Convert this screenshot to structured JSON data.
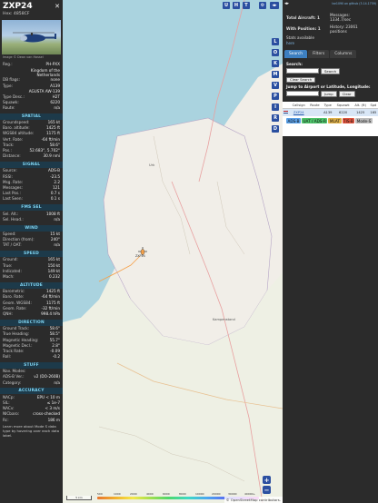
{
  "info": {
    "callsign": "ZXP24",
    "hex_line": "Hex: 4858CF",
    "photo_credit": "Image © Dean van Hassel",
    "basic": [
      {
        "k": "Reg.:",
        "v": "PH-PXX"
      },
      {
        "k": "",
        "v": "Kingdom of the Netherlands"
      },
      {
        "k": "DB flags:",
        "v": "none"
      },
      {
        "k": "Type:",
        "v": "A139"
      },
      {
        "k": "",
        "v": "AGUSTA AW-139"
      },
      {
        "k": "Type Desc.:",
        "v": "H2T"
      },
      {
        "k": "Squawk:",
        "v": "6220"
      },
      {
        "k": "Route:",
        "v": "n/a"
      }
    ],
    "sections": [
      {
        "title": "SPATIAL",
        "rows": [
          {
            "k": "Groundspeed:",
            "v": "165 kt"
          },
          {
            "k": "Baro. altitude:",
            "v": "1425 ft"
          },
          {
            "k": "WGS84 altitude:",
            "v": "1175 ft"
          },
          {
            "k": "Vert. Rate:",
            "v": "-64 ft/min"
          },
          {
            "k": "Track:",
            "v": "58.6°"
          },
          {
            "k": "Pos.:",
            "v": "52.683°, 5.702°"
          },
          {
            "k": "Distance:",
            "v": "30.9 nmi"
          }
        ]
      },
      {
        "title": "SIGNAL",
        "rows": [
          {
            "k": "Source:",
            "v": "ADS-B"
          },
          {
            "k": "RSSI:",
            "v": "-23.5"
          },
          {
            "k": "Msg. Rate:",
            "v": "2.2"
          },
          {
            "k": "Messages:",
            "v": "121"
          },
          {
            "k": "Last Pos.:",
            "v": "0.7 s"
          },
          {
            "k": "Last Seen:",
            "v": "0.1 s"
          }
        ]
      },
      {
        "title": "FMS SEL",
        "rows": [
          {
            "k": "Sel. Alt.:",
            "v": "1008 ft"
          },
          {
            "k": "Sel. Head.:",
            "v": "n/a"
          }
        ]
      },
      {
        "title": "WIND",
        "rows": [
          {
            "k": "Speed:",
            "v": "15 kt"
          },
          {
            "k": "Direction (from):",
            "v": "240°"
          },
          {
            "k": "TAT / OAT:",
            "v": "n/a"
          }
        ]
      },
      {
        "title": "SPEED",
        "rows": [
          {
            "k": "Ground:",
            "v": "165 kt"
          },
          {
            "k": "True:",
            "v": "150 kt"
          },
          {
            "k": "Indicated:",
            "v": "149 kt"
          },
          {
            "k": "Mach:",
            "v": "0.232"
          }
        ]
      },
      {
        "title": "ALTITUDE",
        "rows": [
          {
            "k": "Barometric:",
            "v": "1425 ft"
          },
          {
            "k": "Baro. Rate:",
            "v": "-64 ft/min"
          },
          {
            "k": "Geom. WGS84:",
            "v": "1175 ft"
          },
          {
            "k": "Geom. Rate:",
            "v": "-32 ft/min"
          },
          {
            "k": "QNH:",
            "v": "998.4 hPa"
          }
        ]
      },
      {
        "title": "DIRECTION",
        "rows": [
          {
            "k": "Ground Track:",
            "v": "58.6°"
          },
          {
            "k": "True Heading:",
            "v": "58.5°"
          },
          {
            "k": "Magnetic Heading:",
            "v": "55.7°"
          },
          {
            "k": "Magnetic Decl.:",
            "v": "2.8°"
          },
          {
            "k": "Track Rate:",
            "v": "-0.09"
          },
          {
            "k": "Roll:",
            "v": "-0.2"
          }
        ]
      },
      {
        "title": "STUFF",
        "rows": [
          {
            "k": "Nav. Modes:",
            "v": ""
          },
          {
            "k": "ADS-B Ver.:",
            "v": "v2 (DO-260B)"
          },
          {
            "k": "Category:",
            "v": "n/a"
          }
        ]
      },
      {
        "title": "ACCURACY",
        "rows": [
          {
            "k": "NACp:",
            "v": "EPU < 10 m"
          },
          {
            "k": "SIL:",
            "v": "≤ 1e-7"
          },
          {
            "k": "NACv:",
            "v": "< 3 m/s"
          },
          {
            "k": "NICbaro:",
            "v": "cross-checked"
          },
          {
            "k": "Rc:",
            "v": "186 m"
          }
        ]
      }
    ],
    "footnote": "Learn more about Mode S data type by hovering over each data label."
  },
  "map": {
    "top_buttons": [
      "U",
      "H",
      "T"
    ],
    "side_buttons": [
      "L",
      "O",
      "K",
      "M",
      "V",
      "P",
      "I",
      "R",
      "D"
    ],
    "zoom_in": "+",
    "zoom_out": "−",
    "labels": {
      "town1": "Kampenstand",
      "town2": "Urk"
    },
    "scale_label": "5 km",
    "alt_ticks": [
      "500",
      "1000",
      "2000",
      "4000",
      "6000",
      "8000",
      "10000",
      "20000",
      "30000",
      "40000+"
    ],
    "attribution": "© OpenStreetMap contributors.",
    "aircraft_label": "ZXP24"
  },
  "sidebar": {
    "update_link": "tar1090 on github (3.14.1759)",
    "stats": {
      "total_label": "Total Aircraft: 1",
      "messages_label": "Messages:",
      "messages_value": "1334.7/sec",
      "with_pos_label": "With Position: 1",
      "history_label": "History: 23061 positions",
      "stats_avail": "Stats available",
      "here": "here"
    },
    "tabs": [
      "Search",
      "Filters",
      "Columns"
    ],
    "search_label": "Search:",
    "search_btn": "Search",
    "clear_search_btn": "Clear Search",
    "jump_label": "Jump to Airport or Latitude, Longitude:",
    "jump_btn": "Jump",
    "clear_btn": "Clear",
    "table": {
      "headers": [
        "",
        "Callsign",
        "Route",
        "Type",
        "Squawk",
        "Alt. (ft)",
        "Spd"
      ],
      "rows": [
        [
          "",
          "ZXP24",
          "",
          "A139",
          "6220",
          "1425",
          "165"
        ]
      ]
    },
    "sources": [
      {
        "label": "ADS-B",
        "color": "#5aa0e8"
      },
      {
        "label": "UAT / ADS-R",
        "color": "#4ec36a"
      },
      {
        "label": "MLAT",
        "color": "#e0b14a"
      },
      {
        "label": "TIS-B",
        "color": "#e0553f"
      },
      {
        "label": "Mode-S",
        "color": "#bdbdbd"
      }
    ]
  },
  "colors": {
    "sectionBg": "#1d3a4a",
    "sectionText": "#7fd4f2",
    "panelBg": "#2b2b2b",
    "accent": "#3d7fc0",
    "mapLand": "#f1eee8",
    "mapWater": "#aad3df",
    "aircraft": "#f5a14a"
  }
}
